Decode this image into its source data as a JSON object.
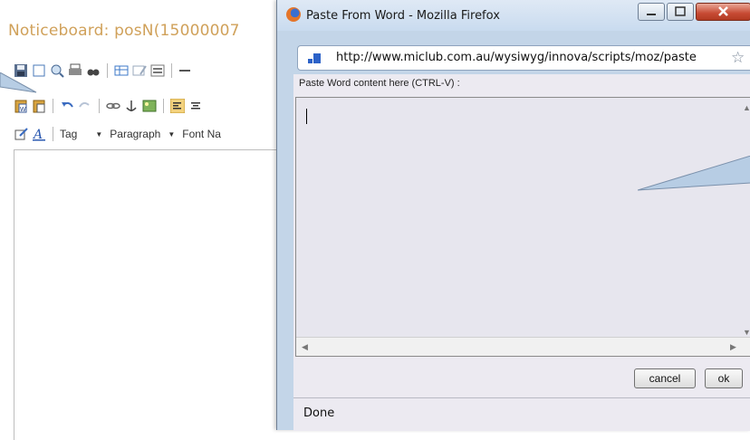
{
  "background_page": {
    "title": "Noticeboard: posN(15000007",
    "toolbar": {
      "tag_select": "Tag",
      "paragraph_select": "Paragraph",
      "font_select": "Font Na"
    }
  },
  "popup": {
    "window_title": "Paste From Word - Mozilla Firefox",
    "url": "http://www.miclub.com.au/wysiwyg/innova/scripts/moz/paste",
    "paste_label": "Paste Word content here (CTRL-V) :",
    "cancel_label": "cancel",
    "ok_label": "ok",
    "status": "Done"
  },
  "colors": {
    "title_color": "#d0a15a",
    "callout_fill": "#b7cde4"
  }
}
